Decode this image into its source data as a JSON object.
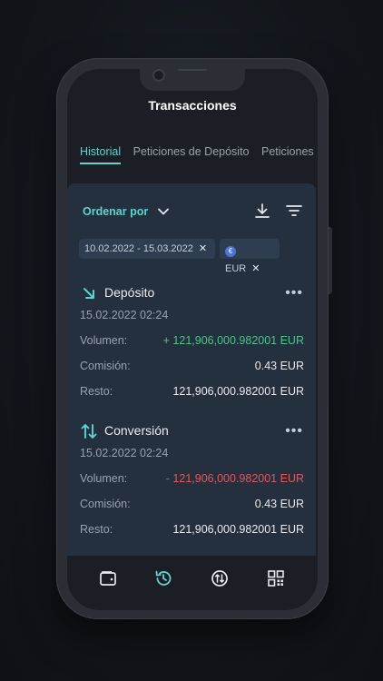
{
  "header": {
    "title": "Transacciones"
  },
  "tabs": [
    {
      "label": "Historial",
      "active": true
    },
    {
      "label": "Peticiones de Depósito",
      "active": false
    },
    {
      "label": "Peticiones",
      "active": false
    }
  ],
  "toolbar": {
    "sort_label": "Ordenar por"
  },
  "filters": {
    "date_range": "10.02.2022 - 15.03.2022",
    "currency": "EUR"
  },
  "transactions": [
    {
      "type": "Depósito",
      "icon": "arrow-down-right-icon",
      "date": "15.02.2022 02:24",
      "rows": [
        {
          "label": "Volumen:",
          "value": "+ 121,906,000.982001 EUR"
        },
        {
          "label": "Comisión:",
          "value": "0.43 EUR"
        },
        {
          "label": "Resto:",
          "value": "121,906,000.982001 EUR"
        }
      ]
    },
    {
      "type": "Conversión",
      "icon": "swap-arrows-icon",
      "date": "15.02.2022 02:24",
      "rows": [
        {
          "label": "Volumen:",
          "value": "- 121,906,000.982001 EUR"
        },
        {
          "label": "Comisión:",
          "value": "0.43 EUR"
        },
        {
          "label": "Resto:",
          "value": "121,906,000.982001 EUR"
        }
      ]
    }
  ],
  "nav": [
    "wallet-icon",
    "history-icon",
    "exchange-icon",
    "qr-grid-icon"
  ],
  "colors": {
    "accent": "#5fd3cf",
    "positive": "#49c58d",
    "negative": "#e0585f",
    "card": "#24303e"
  }
}
